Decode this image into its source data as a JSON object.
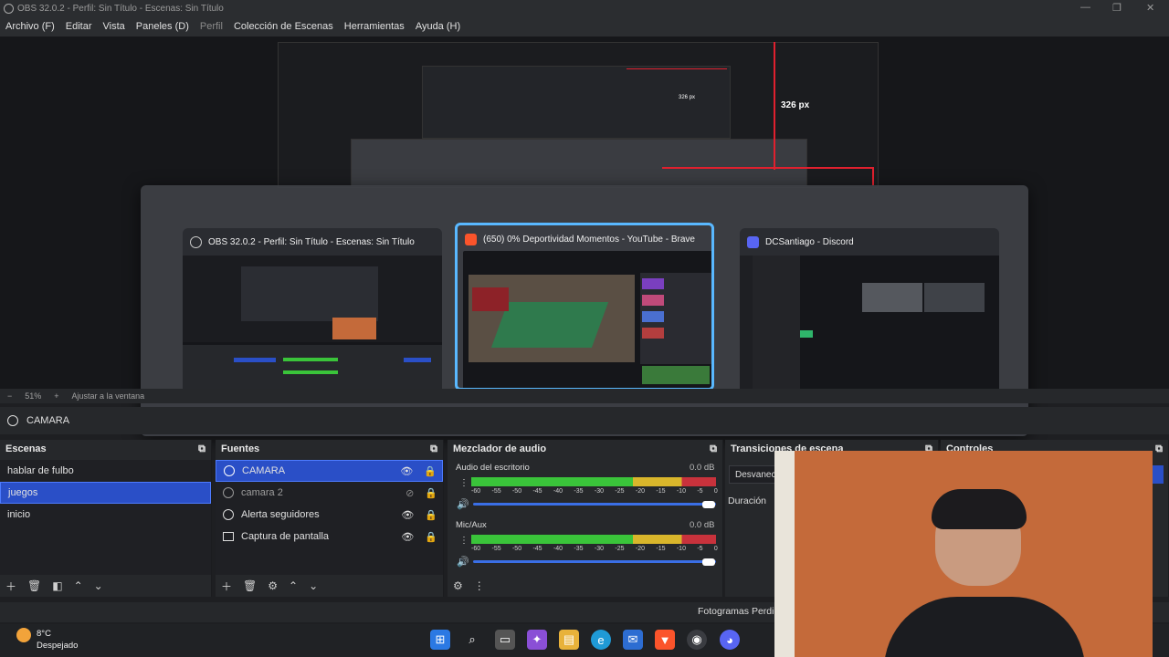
{
  "window": {
    "title": "OBS 32.0.2 - Perfil: Sin Título - Escenas: Sin Título"
  },
  "menu": [
    "Archivo (F)",
    "Editar",
    "Vista",
    "Paneles (D)",
    "Perfil",
    "Colección de Escenas",
    "Herramientas",
    "Ayuda (H)"
  ],
  "preview": {
    "px_label": "326 px",
    "px_label_small": "326 px"
  },
  "switcher": {
    "windows": [
      {
        "title": "OBS 32.0.2 - Perfil: Sin Título - Escenas: Sin Título",
        "icon": "obs-icon"
      },
      {
        "title": "(650) 0% Deportividad Momentos - YouTube - Brave",
        "icon": "brave-icon"
      },
      {
        "title": "DCSantiago - Discord",
        "icon": "discord-icon"
      }
    ],
    "selected_index": 1
  },
  "status_strip": {
    "zoom": "51%",
    "fit_label": "Ajustar a la ventana"
  },
  "source_bar": {
    "label": "CAMARA"
  },
  "docks": {
    "escenas": {
      "title": "Escenas",
      "items": [
        "hablar de fulbo",
        "juegos",
        "inicio"
      ],
      "selected": "juegos"
    },
    "fuentes": {
      "title": "Fuentes",
      "items": [
        "CAMARA",
        "camara 2",
        "Alerta seguidores",
        "Captura de pantalla"
      ],
      "selected": "CAMARA"
    },
    "mezclador": {
      "title": "Mezclador de audio",
      "channels": [
        {
          "name": "Audio del escritorio",
          "db": "0.0 dB"
        },
        {
          "name": "Mic/Aux",
          "db": "0.0 dB"
        }
      ],
      "scale": [
        "-60",
        "-55",
        "-50",
        "-45",
        "-40",
        "-35",
        "-30",
        "-25",
        "-20",
        "-15",
        "-10",
        "-5",
        "0"
      ]
    },
    "transiciones": {
      "title": "Transiciones de escena",
      "transition": "Desvanecer",
      "duration_label": "Duración"
    },
    "controles": {
      "title": "Controles"
    }
  },
  "stats": {
    "dropped_frames_label": "Fotogramas Perdidos"
  },
  "taskbar": {
    "weather_temp": "8°C",
    "weather_desc": "Despejado"
  },
  "colors": {
    "accent": "#2a4fc7",
    "selection_border": "#59b8ff",
    "meter_green": "#3ac43a",
    "meter_yellow": "#d9b62b",
    "meter_red": "#c8323c"
  }
}
